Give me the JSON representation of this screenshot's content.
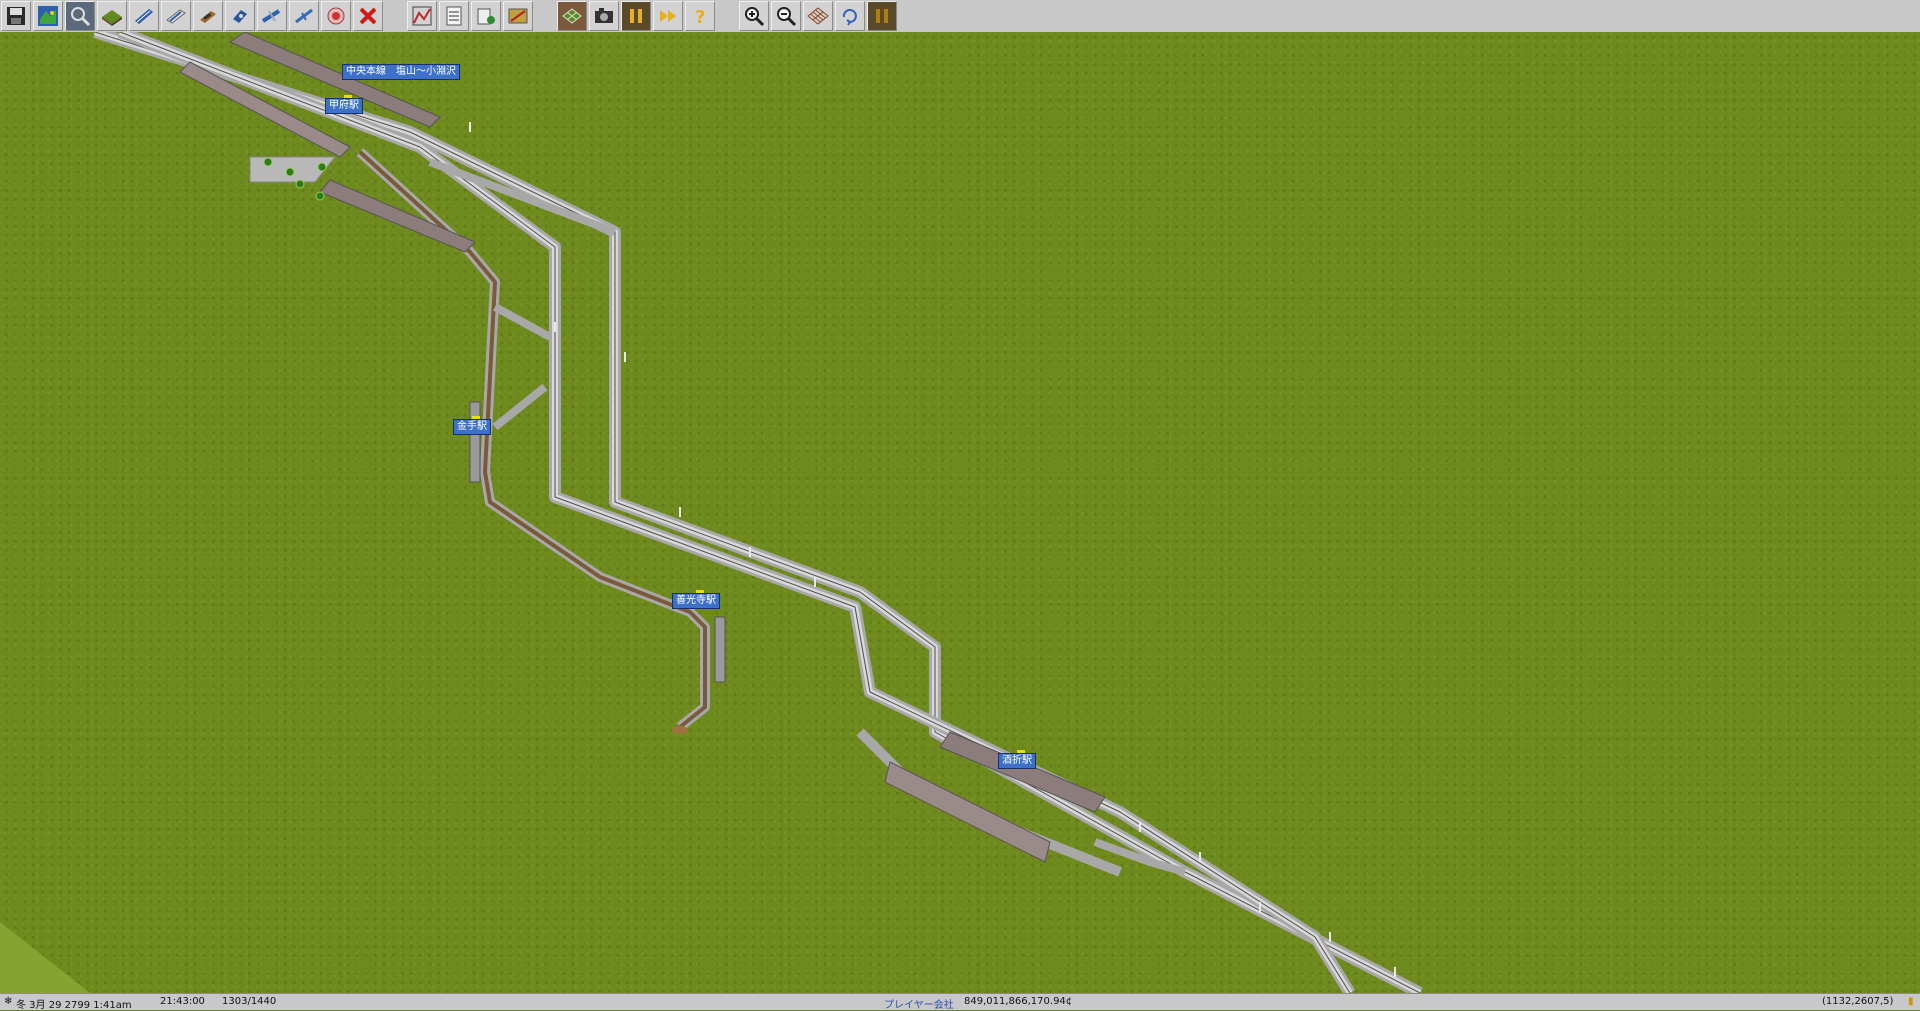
{
  "toolbar": {
    "buttons": [
      {
        "name": "save-button",
        "icon": "floppy-disk-icon"
      },
      {
        "name": "map-button",
        "icon": "minimap-icon"
      },
      {
        "name": "inspect-button",
        "icon": "magnifier-icon"
      },
      {
        "name": "terrain-button",
        "icon": "landscape-icon"
      },
      {
        "name": "rail-button",
        "icon": "rail-icon"
      },
      {
        "name": "monorail-button",
        "icon": "monorail-icon"
      },
      {
        "name": "road-button",
        "icon": "road-icon"
      },
      {
        "name": "ship-button",
        "icon": "ship-icon"
      },
      {
        "name": "airport-button",
        "icon": "airport-icon"
      },
      {
        "name": "airplane-button",
        "icon": "airplane-icon"
      },
      {
        "name": "special-button",
        "icon": "target-icon"
      },
      {
        "name": "remove-button",
        "icon": "red-x-icon"
      },
      {
        "name": "lines-button",
        "icon": "line-graph-icon"
      },
      {
        "name": "list-button",
        "icon": "list-icon"
      },
      {
        "name": "finance-button",
        "icon": "company-icon"
      },
      {
        "name": "goods-button",
        "icon": "goods-icon"
      },
      {
        "name": "grid-button",
        "icon": "grid-icon"
      },
      {
        "name": "screenshot-button",
        "icon": "camera-icon"
      },
      {
        "name": "pause-button",
        "icon": "pause-icon"
      },
      {
        "name": "fast-forward-button",
        "icon": "fast-forward-icon"
      },
      {
        "name": "help-button",
        "icon": "question-mark-icon"
      },
      {
        "name": "zoom-in-button",
        "icon": "zoom-in-icon"
      },
      {
        "name": "zoom-out-button",
        "icon": "zoom-out-icon"
      },
      {
        "name": "view-grid-button",
        "icon": "isometric-grid-icon"
      },
      {
        "name": "rotate-button",
        "icon": "rotate-icon"
      },
      {
        "name": "pause2-button",
        "icon": "pause-icon"
      }
    ]
  },
  "map": {
    "line_label": "中央本線　塩山〜小淵沢",
    "stations": [
      {
        "name": "甲府駅"
      },
      {
        "name": "金手駅"
      },
      {
        "name": "善光寺駅"
      },
      {
        "name": "酒折駅"
      }
    ]
  },
  "status": {
    "date": "冬 3月 29 2799  1:41am",
    "time": "21:43:00",
    "speed": "1303/1440",
    "company": "プレイヤー会社",
    "money": "849,011,866,170.94¢",
    "coords": "(1132,2607,5)"
  },
  "colors": {
    "grass": "#6e891d",
    "ui_gray": "#c8c8c8",
    "label_blue": "#3d70c8",
    "rail_bed": "#b8b8b8",
    "rail_track": "#5a4a3a",
    "platform": "#8c7c7c"
  }
}
